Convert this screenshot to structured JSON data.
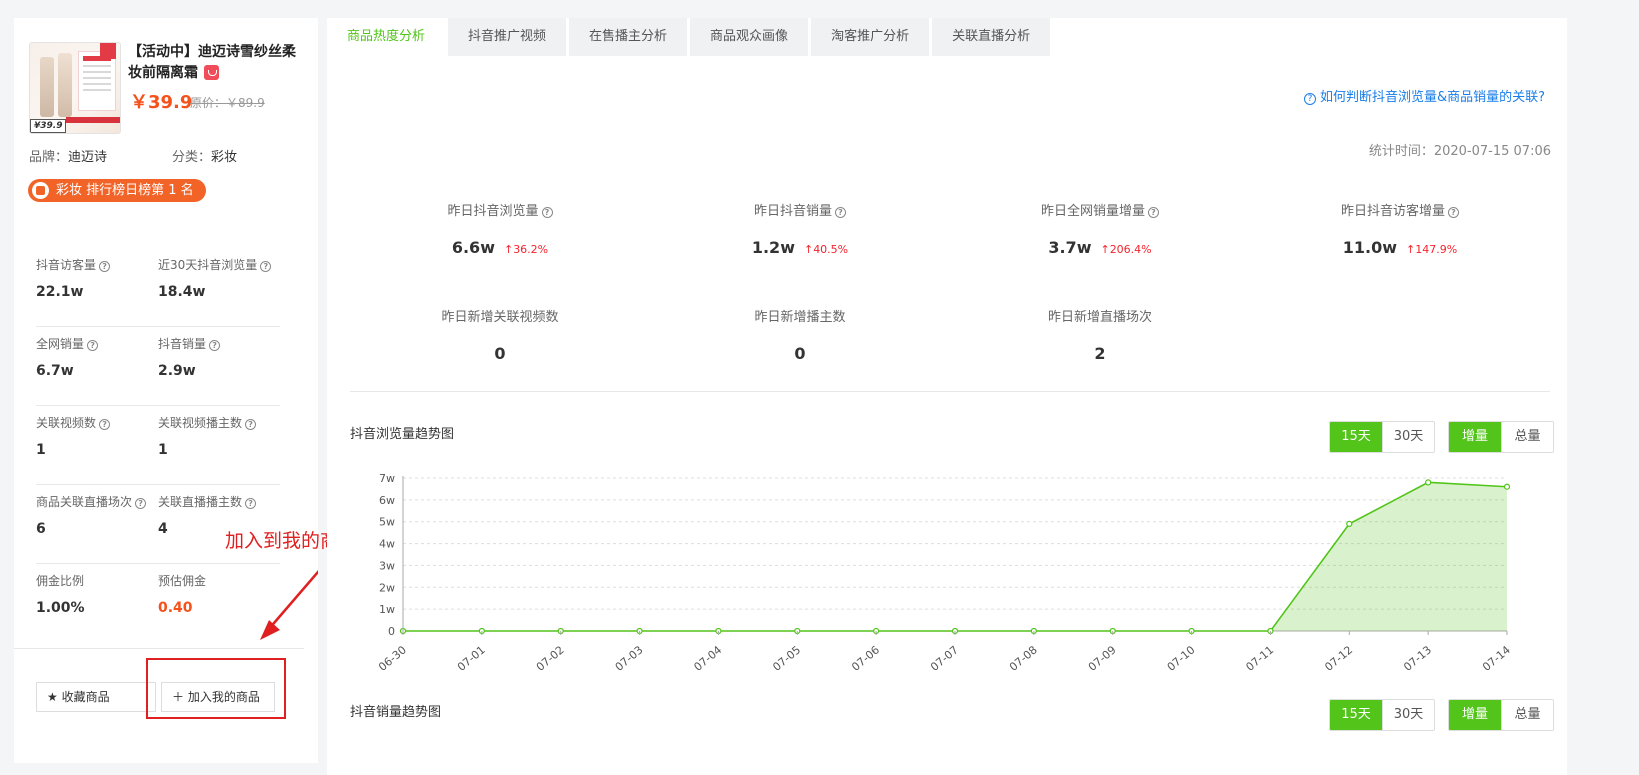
{
  "product": {
    "title": "【活动中】迪迈诗雪纱丝柔妆前隔离霜",
    "price": "￥39.9",
    "original_price": "原价：￥89.9",
    "brand_label": "品牌：",
    "brand": "迪迈诗",
    "category_label": "分类：",
    "category": "彩妆",
    "rank": "彩妆 排行榜日榜第 1 名",
    "image_price": "¥39.9"
  },
  "left_stats": [
    {
      "label": "抖音访客量",
      "value": "22.1w",
      "help": true
    },
    {
      "label": "近30天抖音浏览量",
      "value": "18.4w",
      "help": true
    },
    {
      "label": "全网销量",
      "value": "6.7w",
      "help": true
    },
    {
      "label": "抖音销量",
      "value": "2.9w",
      "help": true
    },
    {
      "label": "关联视频数",
      "value": "1",
      "help": true
    },
    {
      "label": "关联视频播主数",
      "value": "1",
      "help": true
    },
    {
      "label": "商品关联直播场次",
      "value": "6",
      "help": true
    },
    {
      "label": "关联直播播主数",
      "value": "4",
      "help": true
    },
    {
      "label": "佣金比例",
      "value": "1.00%",
      "help": false
    },
    {
      "label": "预估佣金",
      "value": "0.40",
      "help": false
    }
  ],
  "actions": {
    "favorite": "收藏商品",
    "add": "加入我的商品",
    "favorite_icon": "star-icon",
    "add_icon": "plus-icon"
  },
  "annotation": {
    "text": "加入到我的商品",
    "color": "#e02020"
  },
  "tabs": [
    "商品热度分析",
    "抖音推广视频",
    "在售播主分析",
    "商品观众画像",
    "淘客推广分析",
    "关联直播分析"
  ],
  "help_link": "如何判断抖音浏览量&商品销量的关联?",
  "stat_time": "统计时间：2020-07-15 07:06",
  "metrics": [
    {
      "label": "昨日抖音浏览量",
      "value": "6.6w",
      "change": "36.2%",
      "help": true
    },
    {
      "label": "昨日抖音销量",
      "value": "1.2w",
      "change": "40.5%",
      "help": true
    },
    {
      "label": "昨日全网销量增量",
      "value": "3.7w",
      "change": "206.4%",
      "help": true
    },
    {
      "label": "昨日抖音访客增量",
      "value": "11.0w",
      "change": "147.9%",
      "help": true
    },
    {
      "label": "昨日新增关联视频数",
      "value": "0"
    },
    {
      "label": "昨日新增播主数",
      "value": "0"
    },
    {
      "label": "昨日新增直播场次",
      "value": "2"
    }
  ],
  "controls": {
    "range_15": "15天",
    "range_30": "30天",
    "mode_inc": "增量",
    "mode_total": "总量"
  },
  "chart1_title": "抖音浏览量趋势图",
  "chart2_title": "抖音销量趋势图",
  "colors": {
    "accent": "#52c41a",
    "price": "#f5511c",
    "up": "#f5222d",
    "link": "#1a7ee8"
  },
  "chart_data": {
    "type": "area",
    "title": "抖音浏览量趋势图",
    "x": [
      "06-30",
      "07-01",
      "07-02",
      "07-03",
      "07-04",
      "07-05",
      "07-06",
      "07-07",
      "07-08",
      "07-09",
      "07-10",
      "07-11",
      "07-12",
      "07-13",
      "07-14"
    ],
    "series": [
      {
        "values": [
          0,
          0,
          0,
          0,
          0,
          0,
          0,
          0,
          0,
          0,
          0,
          0,
          49000,
          68000,
          66000
        ]
      }
    ],
    "y_ticks": [
      "0",
      "1w",
      "2w",
      "3w",
      "4w",
      "5w",
      "6w",
      "7w"
    ],
    "ylim": [
      0,
      70000
    ],
    "grid": true
  }
}
